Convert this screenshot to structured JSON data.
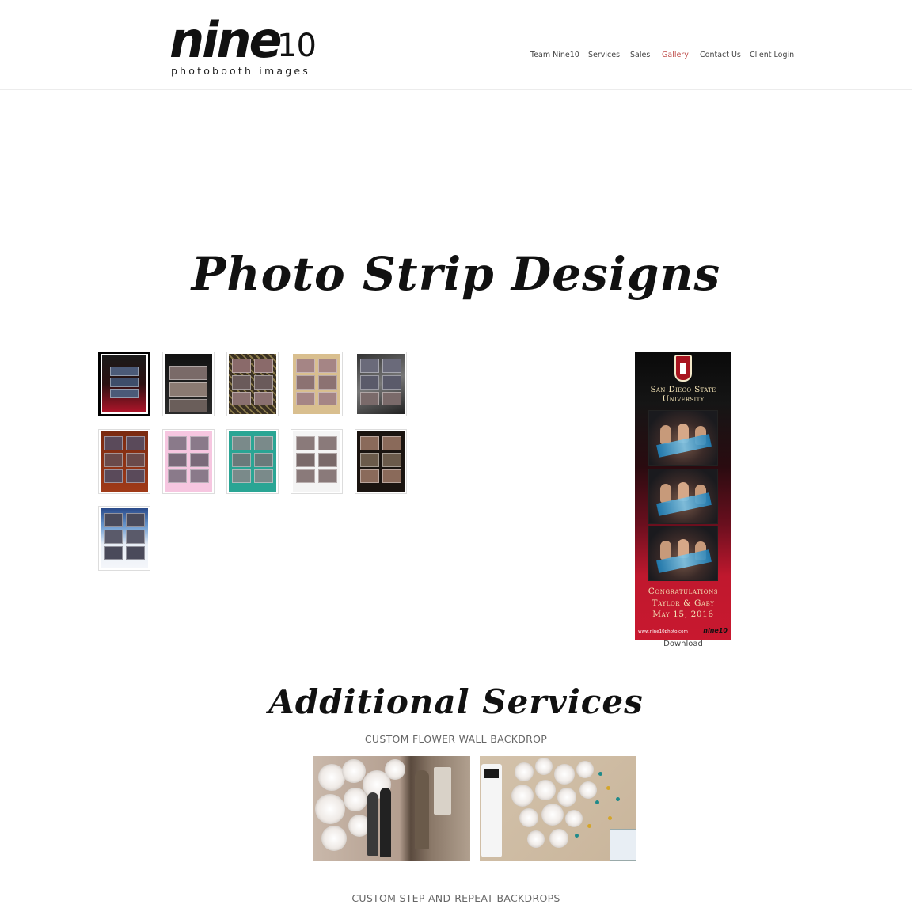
{
  "header": {
    "logo": {
      "word": "nine",
      "number": "10",
      "tagline": "photobooth images"
    },
    "nav": [
      {
        "label": "Team Nine10"
      },
      {
        "label": "Services"
      },
      {
        "label": "Sales"
      },
      {
        "label": "Gallery",
        "active": true
      },
      {
        "label": "Contact Us"
      },
      {
        "label": "Client Login"
      }
    ],
    "active_color": "#c0504d"
  },
  "gallery": {
    "title": "Photo Strip Designs",
    "thumbnail_count": 11,
    "selected_index": 0,
    "preview": {
      "school": "San Diego State University",
      "congrats_line1": "Congratulations",
      "congrats_line2": "Taylor & Gaby",
      "date": "May 15, 2016",
      "footer_url": "www.nine10photo.com",
      "footer_logo": "nine10",
      "download_label": "Download"
    }
  },
  "services": {
    "title": "Additional Services",
    "items": [
      {
        "label": "CUSTOM FLOWER WALL BACKDROP"
      },
      {
        "label": "CUSTOM STEP-AND-REPEAT BACKDROPS"
      }
    ]
  }
}
